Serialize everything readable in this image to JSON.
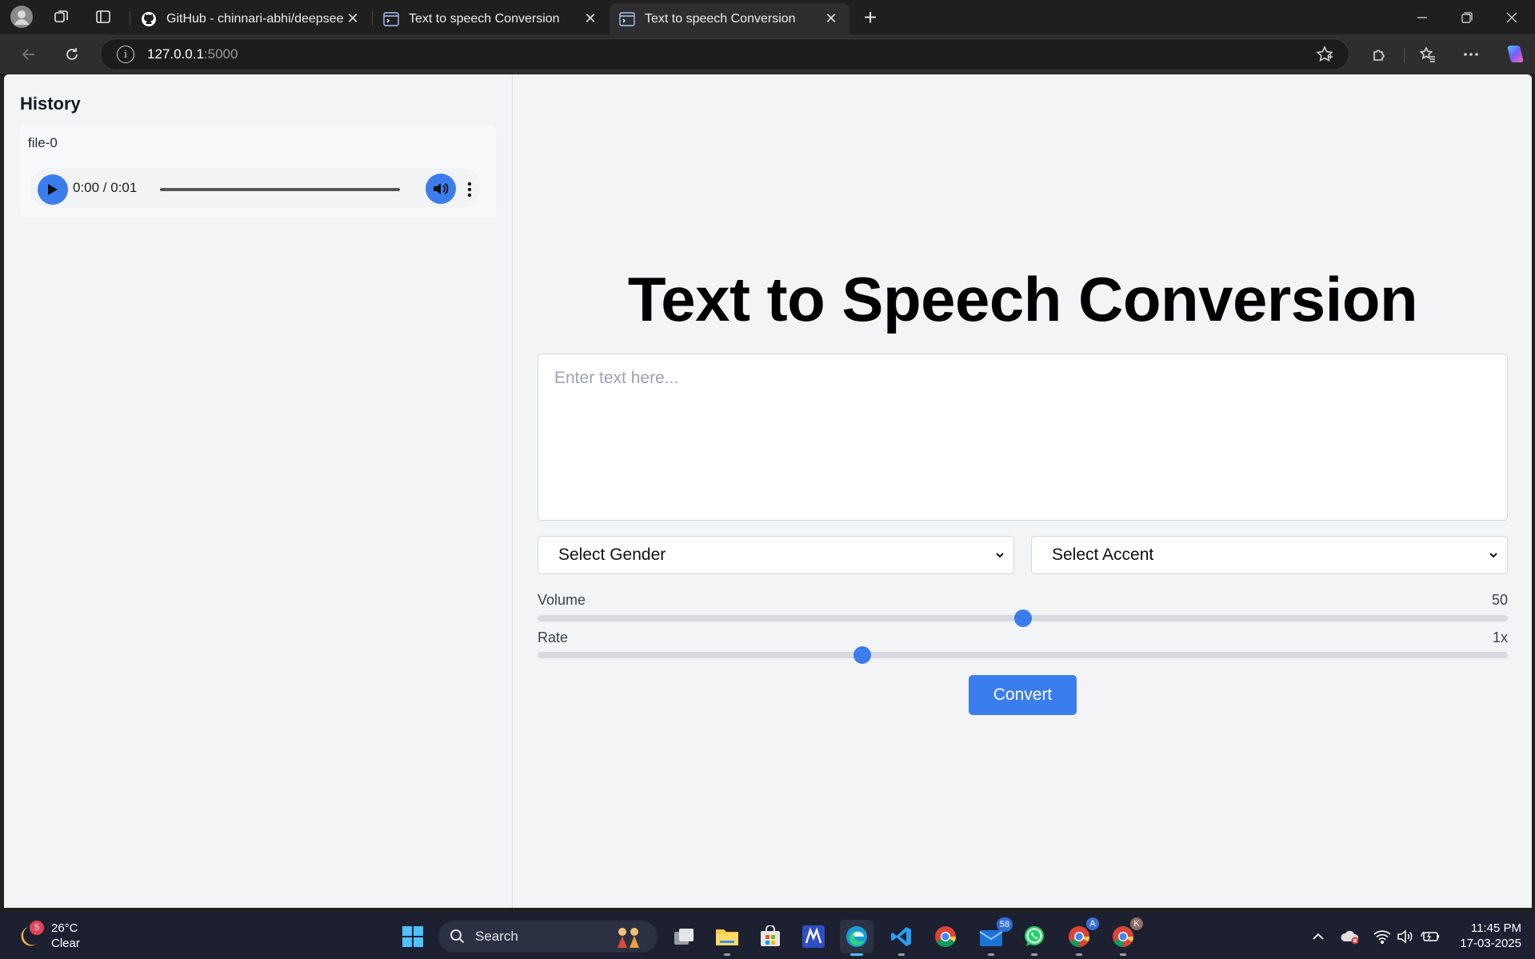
{
  "browser": {
    "tabs": [
      {
        "title": "GitHub - chinnari-abhi/deepseek",
        "active": false
      },
      {
        "title": "Text to speech Conversion",
        "active": false
      },
      {
        "title": "Text to speech Conversion",
        "active": true
      }
    ],
    "url_host": "127.0.0.1",
    "url_port": ":5000"
  },
  "sidebar": {
    "title": "History",
    "items": [
      {
        "name": "file-0",
        "time": "0:00 / 0:01"
      }
    ]
  },
  "main": {
    "title": "Text to Speech Conversion",
    "text_placeholder": "Enter text here...",
    "gender_select": "Select Gender",
    "accent_select": "Select Accent",
    "volume": {
      "label": "Volume",
      "value": "50",
      "level": 0.5
    },
    "rate": {
      "label": "Rate",
      "value": "1x",
      "level": 0.335
    },
    "convert_label": "Convert"
  },
  "taskbar": {
    "weather_badge": "5",
    "temperature": "26°C",
    "condition": "Clear",
    "search_label": "Search",
    "mail_badge": "58",
    "chrome_badge_1": "A",
    "chrome_badge_2": "K",
    "time": "11:45 PM",
    "date": "17-03-2025"
  },
  "colors": {
    "accent": "#3b7ded",
    "page_bg": "#f3f4f6"
  }
}
